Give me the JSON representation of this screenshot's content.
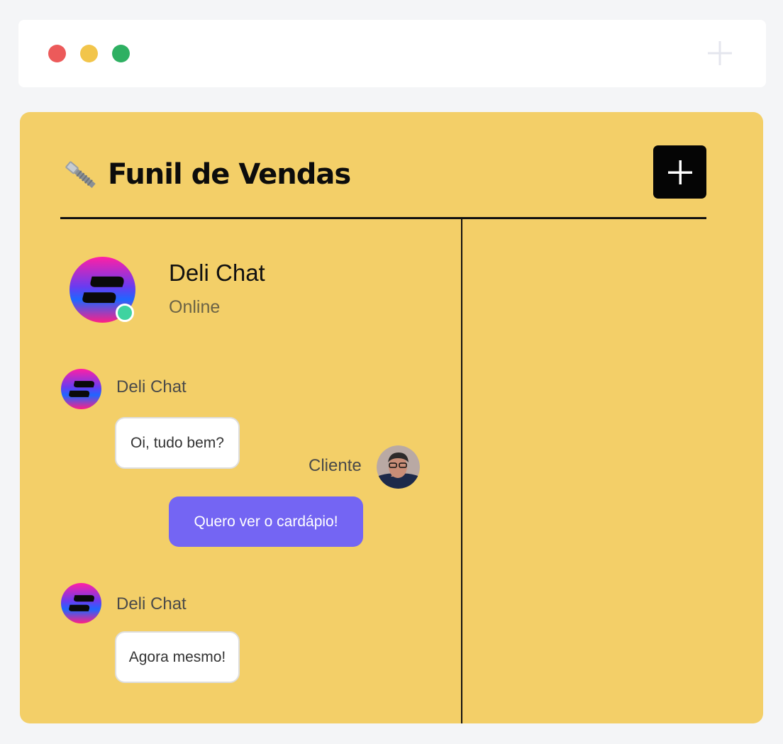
{
  "window": {
    "controls": [
      "close",
      "minimize",
      "maximize"
    ],
    "new_tab_icon": "plus-icon"
  },
  "panel": {
    "title": "Funil de Vendas",
    "title_icon": "wrench-bolt-icon",
    "add_button_icon": "plus-icon",
    "background": "#f3cf68"
  },
  "contact": {
    "name": "Deli Chat",
    "status": "Online",
    "status_color": "#3fd3a0"
  },
  "messages": [
    {
      "sender": "Deli Chat",
      "text": "Oi, tudo bem?",
      "from": "bot"
    },
    {
      "sender": "Cliente",
      "text": "Quero ver o cardápio!",
      "from": "client"
    },
    {
      "sender": "Deli Chat",
      "text": "Agora mesmo!",
      "from": "bot"
    }
  ],
  "colors": {
    "accent": "#7465f3",
    "close": "#ec5a5a",
    "minimize": "#f2c54b",
    "maximize": "#2eb062"
  }
}
